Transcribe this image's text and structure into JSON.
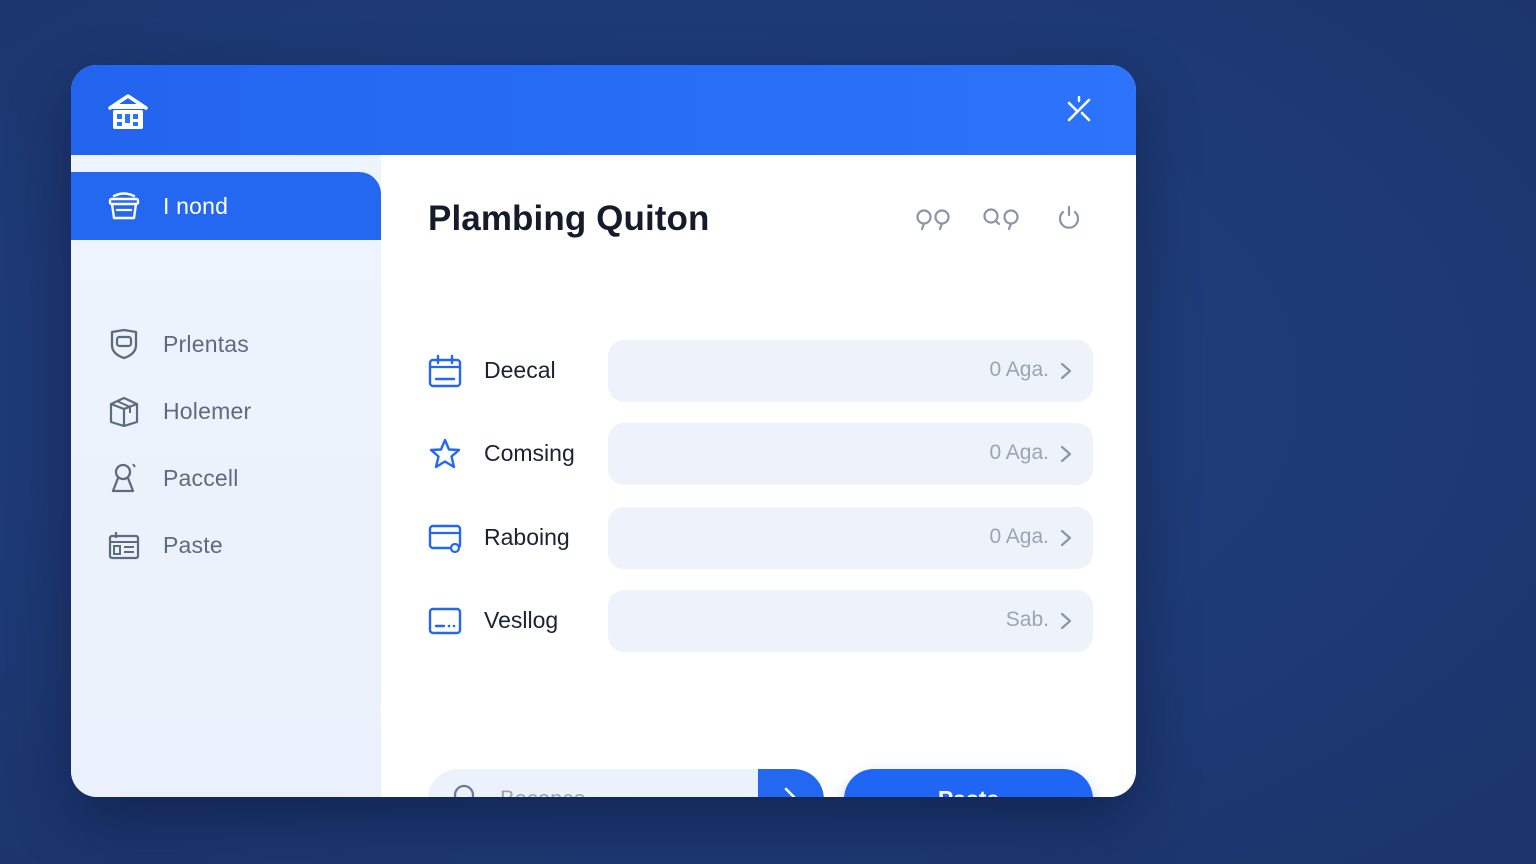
{
  "colors": {
    "accent": "#2468f2",
    "titlebar": "#2b74fb",
    "background": "#1e3a75",
    "sidebar": "#eef4fd",
    "field": "#eef3fb"
  },
  "titlebar": {
    "logo_icon": "house-icon",
    "close_icon": "close-icon"
  },
  "sidebar": {
    "items": [
      {
        "label": "I nond",
        "icon": "basket-icon",
        "active": true
      },
      {
        "label": "Prlentas",
        "icon": "shield-icon",
        "active": false
      },
      {
        "label": "Holemer",
        "icon": "package-icon",
        "active": false
      },
      {
        "label": "Paccell",
        "icon": "person-icon",
        "active": false
      },
      {
        "label": "Paste",
        "icon": "id-card-icon",
        "active": false
      }
    ]
  },
  "main": {
    "title": "Plambing Quiton",
    "header_icons": [
      "glasses-icon",
      "search-glasses-icon",
      "refresh-icon"
    ],
    "rows": [
      {
        "name": "Deecal",
        "value": "0 Aga.",
        "icon": "calendar-icon"
      },
      {
        "name": "Comsing",
        "value": "0 Aga.",
        "icon": "star-icon"
      },
      {
        "name": "Raboing",
        "value": "0 Aga.",
        "icon": "card-icon"
      },
      {
        "name": "Vesllog",
        "value": "Sab.",
        "icon": "monitor-icon"
      }
    ],
    "search": {
      "placeholder": "Beconce",
      "value": ""
    },
    "paste_button": "Paste"
  }
}
